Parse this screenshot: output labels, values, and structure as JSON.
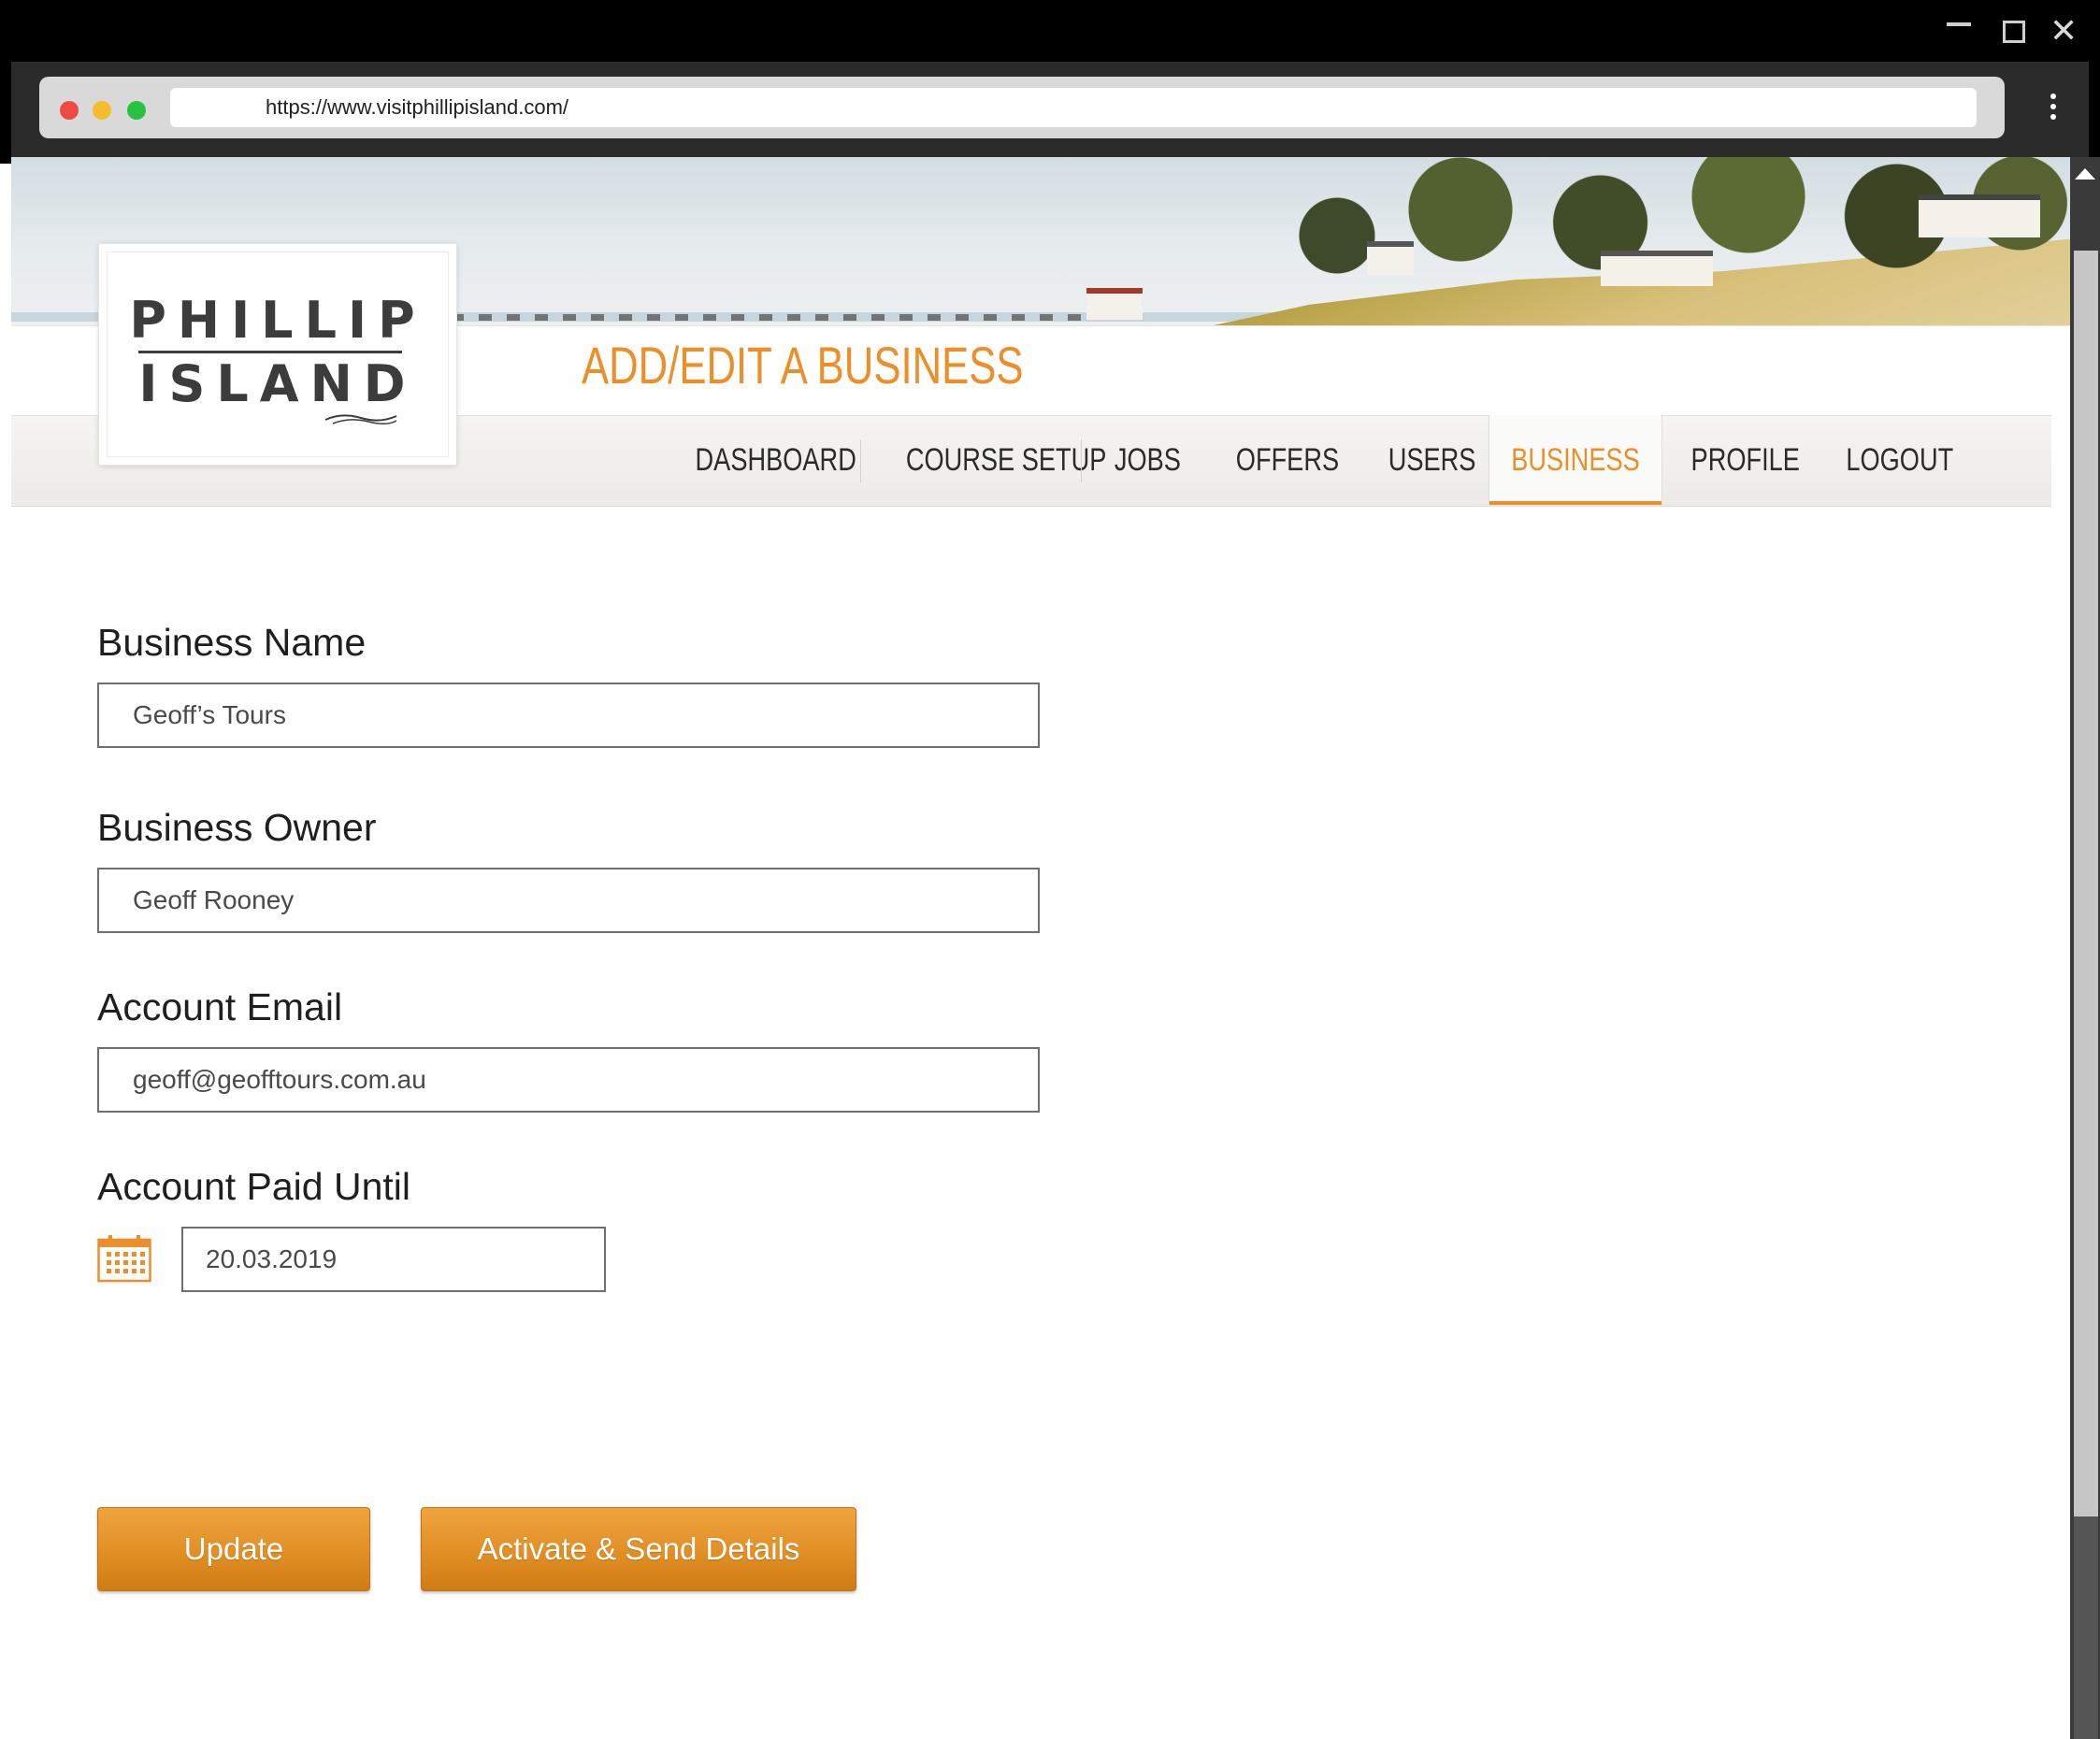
{
  "browser": {
    "url": "https://www.visitphillipisland.com/"
  },
  "logo": {
    "line1": "PHILLIP",
    "line2": "ISLAND"
  },
  "header": {
    "title": "ADD/EDIT A BUSINESS"
  },
  "nav": {
    "items": [
      {
        "label": "DASHBOARD"
      },
      {
        "label": "COURSE SETUP"
      },
      {
        "label": "JOBS"
      },
      {
        "label": "OFFERS"
      },
      {
        "label": "USERS"
      },
      {
        "label": "BUSINESS",
        "active": true
      },
      {
        "label": "PROFILE"
      },
      {
        "label": "LOGOUT"
      }
    ]
  },
  "form": {
    "business_name": {
      "label": "Business Name",
      "value": "Geoff’s Tours"
    },
    "business_owner": {
      "label": "Business Owner",
      "value": "Geoff Rooney"
    },
    "account_email": {
      "label": "Account Email",
      "value": "geoff@geofftours.com.au"
    },
    "account_paid_until": {
      "label": "Account Paid Until",
      "value": "20.03.2019"
    }
  },
  "buttons": {
    "update": "Update",
    "activate": "Activate & Send Details"
  },
  "colors": {
    "accent": "#ec8f2a",
    "button": "#e18f25"
  },
  "icons": {
    "calendar": "calendar-icon",
    "menu": "kebab-menu-icon"
  }
}
